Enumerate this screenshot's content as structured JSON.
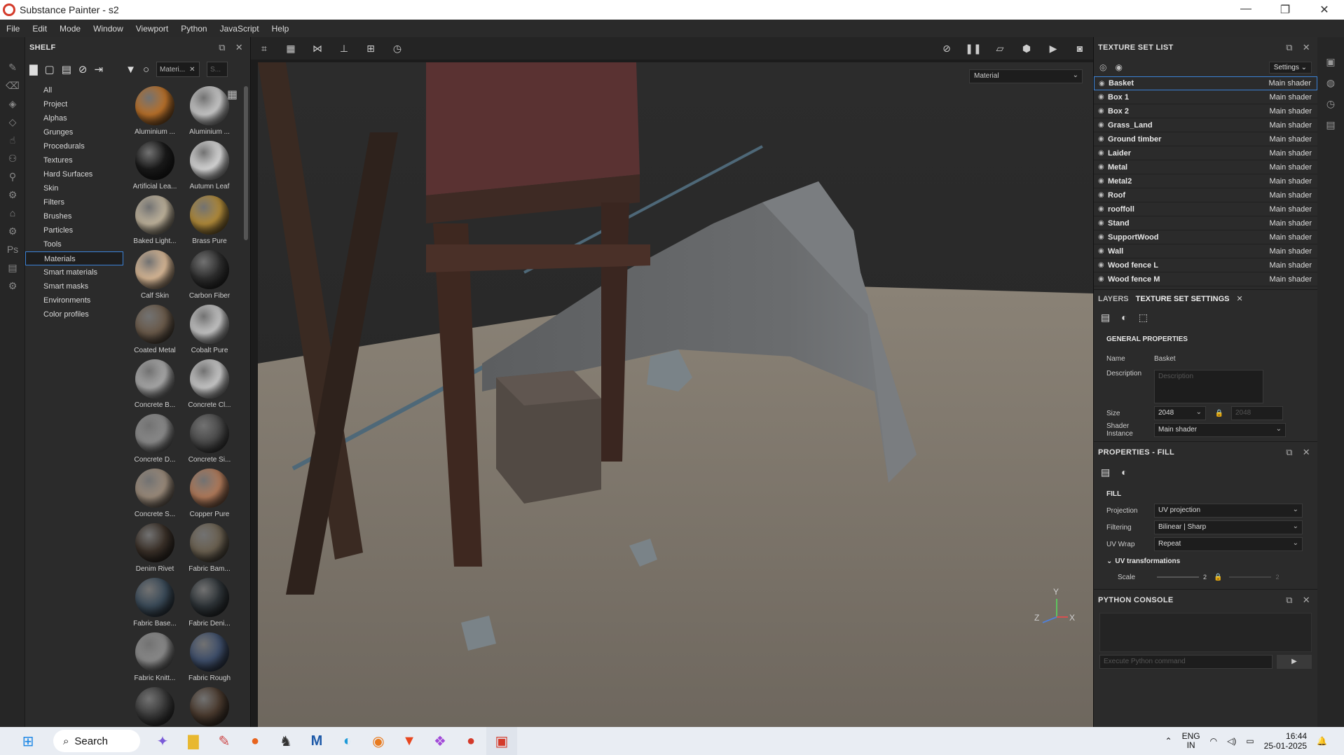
{
  "window": {
    "title": "Substance Painter - s2",
    "controls": [
      "—",
      "❐",
      "✕"
    ]
  },
  "menu": [
    "File",
    "Edit",
    "Mode",
    "Window",
    "Viewport",
    "Python",
    "JavaScript",
    "Help"
  ],
  "shelf": {
    "title": "SHELF",
    "filter_chip": "Materi...",
    "search_placeholder": "S...",
    "categories": [
      "All",
      "Project",
      "Alphas",
      "Grunges",
      "Procedurals",
      "Textures",
      "Hard Surfaces",
      "Skin",
      "Filters",
      "Brushes",
      "Particles",
      "Tools",
      "Materials",
      "Smart materials",
      "Smart masks",
      "Environments",
      "Color profiles"
    ],
    "selected_category": "Materials",
    "materials": [
      {
        "label": "Aluminium ...",
        "color": "#b8702a"
      },
      {
        "label": "Aluminium ...",
        "color": "#c8c8c8"
      },
      {
        "label": "Artificial Lea...",
        "color": "#1a1a1a"
      },
      {
        "label": "Autumn Leaf",
        "color": "#d8d8d8"
      },
      {
        "label": "Baked Light...",
        "color": "#bfb39c"
      },
      {
        "label": "Brass Pure",
        "color": "#b08a3a"
      },
      {
        "label": "Calf Skin",
        "color": "#d8b896"
      },
      {
        "label": "Carbon Fiber",
        "color": "#2e2e2e"
      },
      {
        "label": "Coated Metal",
        "color": "#6a5a4a"
      },
      {
        "label": "Cobalt Pure",
        "color": "#c4c4c4"
      },
      {
        "label": "Concrete B...",
        "color": "#a8a8a8"
      },
      {
        "label": "Concrete Cl...",
        "color": "#c8c8c8"
      },
      {
        "label": "Concrete D...",
        "color": "#8a8a8a"
      },
      {
        "label": "Concrete Si...",
        "color": "#4a4a4a"
      },
      {
        "label": "Concrete S...",
        "color": "#9a8a7a"
      },
      {
        "label": "Copper Pure",
        "color": "#b07a5a"
      },
      {
        "label": "Denim Rivet",
        "color": "#3a3028"
      },
      {
        "label": "Fabric Bam...",
        "color": "#6a6050"
      },
      {
        "label": "Fabric Base...",
        "color": "#3a4a58"
      },
      {
        "label": "Fabric Deni...",
        "color": "#2e3438"
      },
      {
        "label": "Fabric Knitt...",
        "color": "#8a8a8a"
      },
      {
        "label": "Fabric Rough",
        "color": "#3e4e6a"
      },
      {
        "label": "",
        "color": "#3a3a3a"
      },
      {
        "label": "",
        "color": "#4a3a2e"
      }
    ]
  },
  "viewport": {
    "mode_dropdown": "Material",
    "axis": {
      "y": "Y",
      "z": "Z",
      "x": "X"
    }
  },
  "texture_set_list": {
    "title": "TEXTURE SET LIST",
    "settings": "Settings",
    "items": [
      {
        "name": "Basket",
        "shader": "Main shader"
      },
      {
        "name": "Box 1",
        "shader": "Main shader"
      },
      {
        "name": "Box 2",
        "shader": "Main shader"
      },
      {
        "name": "Grass_Land",
        "shader": "Main shader"
      },
      {
        "name": "Ground timber",
        "shader": "Main shader"
      },
      {
        "name": "Laider",
        "shader": "Main shader"
      },
      {
        "name": "Metal",
        "shader": "Main shader"
      },
      {
        "name": "Metal2",
        "shader": "Main shader"
      },
      {
        "name": "Roof",
        "shader": "Main shader"
      },
      {
        "name": "rooffoll",
        "shader": "Main shader"
      },
      {
        "name": "Stand",
        "shader": "Main shader"
      },
      {
        "name": "SupportWood",
        "shader": "Main shader"
      },
      {
        "name": "Wall",
        "shader": "Main shader"
      },
      {
        "name": "Wood fence L",
        "shader": "Main shader"
      },
      {
        "name": "Wood fence M",
        "shader": "Main shader"
      }
    ]
  },
  "tss": {
    "tab_layers": "LAYERS",
    "tab_tss": "TEXTURE SET SETTINGS",
    "section": "GENERAL PROPERTIES",
    "name_label": "Name",
    "name_value": "Basket",
    "desc_label": "Description",
    "desc_placeholder": "Description",
    "size_label": "Size",
    "size_value": "2048",
    "size_value2": "2048",
    "shader_label": "Shader Instance",
    "shader_value": "Main shader"
  },
  "fill": {
    "title": "PROPERTIES - FILL",
    "section": "FILL",
    "projection_label": "Projection",
    "projection_value": "UV projection",
    "filtering_label": "Filtering",
    "filtering_value": "Bilinear | Sharp",
    "wrap_label": "UV Wrap",
    "wrap_value": "Repeat",
    "uvt_label": "UV transformations",
    "scale_label": "Scale",
    "scale_value": "2",
    "scale_value2": "2"
  },
  "console": {
    "title": "PYTHON CONSOLE",
    "placeholder": "Execute Python command"
  },
  "taskbar": {
    "search": "Search",
    "lang1": "ENG",
    "lang2": "IN",
    "time": "16:44",
    "date": "25-01-2025"
  }
}
